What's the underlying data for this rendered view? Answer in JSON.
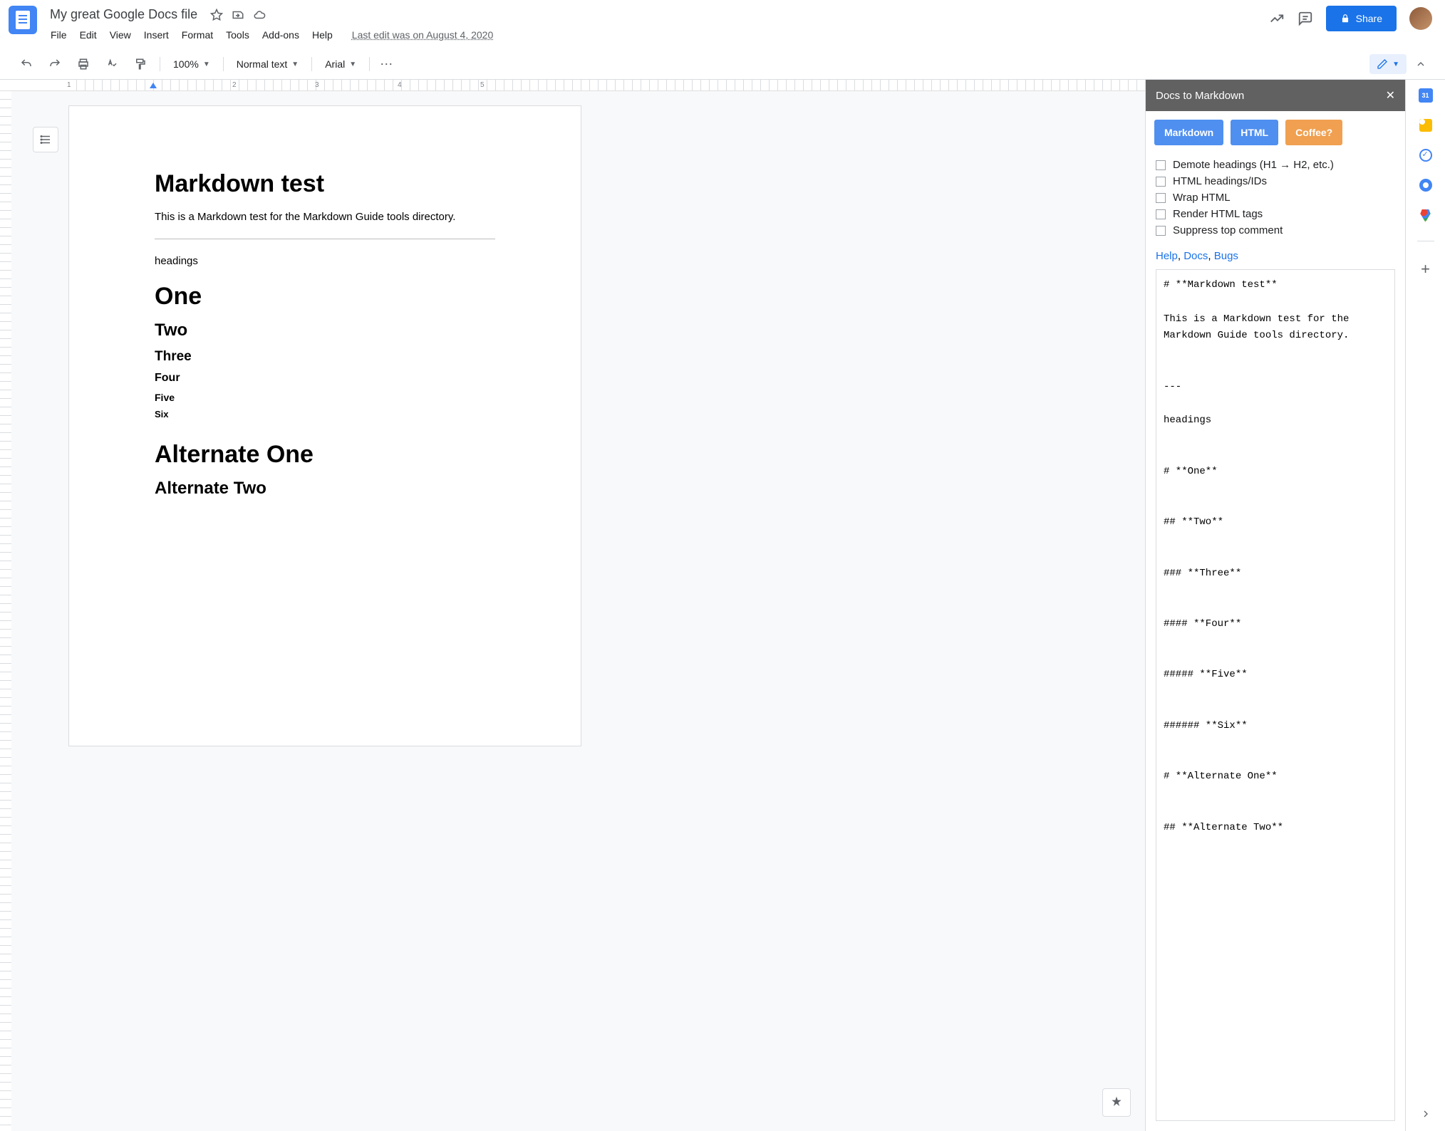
{
  "header": {
    "title": "My great Google Docs file",
    "last_edit": "Last edit was on August 4, 2020",
    "share_label": "Share"
  },
  "menubar": [
    "File",
    "Edit",
    "View",
    "Insert",
    "Format",
    "Tools",
    "Add-ons",
    "Help"
  ],
  "toolbar": {
    "zoom": "100%",
    "style": "Normal text",
    "font": "Arial"
  },
  "ruler_h": [
    "1",
    "2",
    "3",
    "4",
    "5"
  ],
  "document": {
    "title": "Markdown test",
    "intro": "This is a Markdown test for the Markdown Guide tools directory.",
    "headings_label": "headings",
    "h1": "One",
    "h2": "Two",
    "h3": "Three",
    "h4": "Four",
    "h5": "Five",
    "h6": "Six",
    "alt1": "Alternate One",
    "alt2": "Alternate Two"
  },
  "addon": {
    "title": "Docs to Markdown",
    "tabs": {
      "md": "Markdown",
      "html": "HTML",
      "coffee": "Coffee?"
    },
    "checks": [
      "Demote headings (H1 → H2, etc.)",
      "HTML headings/IDs",
      "Wrap HTML",
      "Render HTML tags",
      "Suppress top comment"
    ],
    "links": {
      "help": "Help",
      "docs": "Docs",
      "bugs": "Bugs"
    },
    "output": "# **Markdown test**\n\nThis is a Markdown test for the Markdown Guide tools directory.\n\n\n---\n\nheadings\n\n\n# **One**\n\n\n## **Two**\n\n\n### **Three**\n\n\n#### **Four**\n\n\n##### **Five**\n\n\n###### **Six**\n\n\n# **Alternate One**\n\n\n## **Alternate Two**"
  },
  "sidepanel": {
    "calendar_day": "31"
  }
}
